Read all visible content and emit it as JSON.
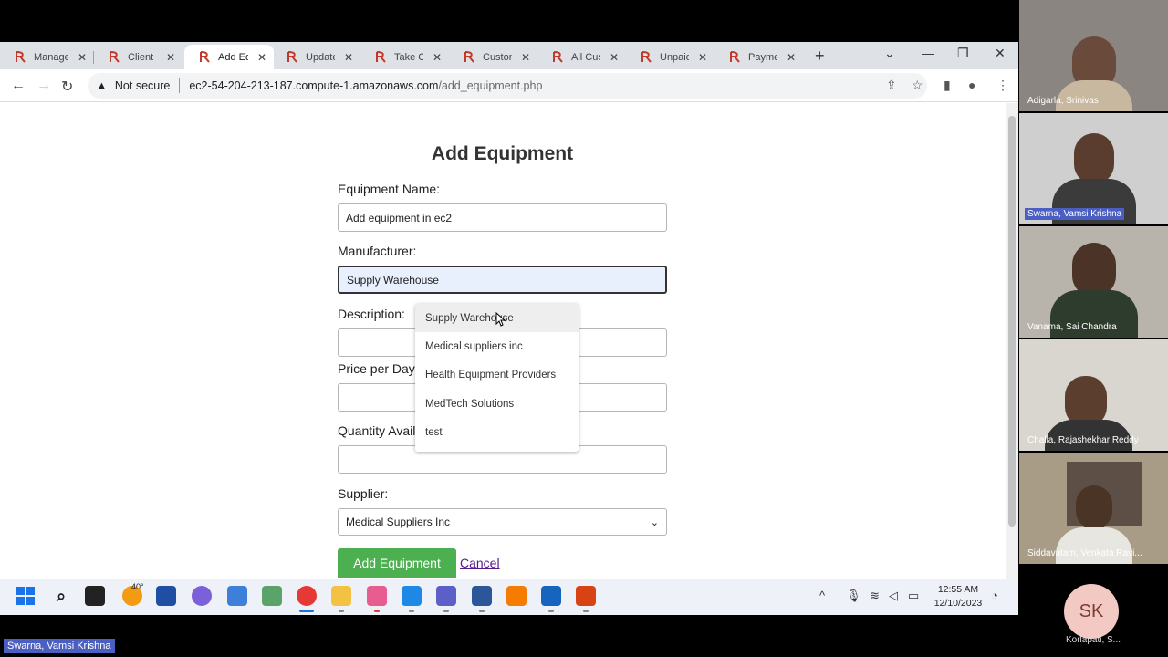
{
  "tabs": [
    {
      "label": "Manage"
    },
    {
      "label": "Client D"
    },
    {
      "label": "Add Equ"
    },
    {
      "label": "Update"
    },
    {
      "label": "Take Or"
    },
    {
      "label": "Custom"
    },
    {
      "label": "All Cust"
    },
    {
      "label": "Unpaid"
    },
    {
      "label": "Paymen"
    }
  ],
  "address_bar": {
    "security_text": "Not secure",
    "host": "ec2-54-204-213-187.compute-1.amazonaws.com",
    "path": "/add_equipment.php"
  },
  "form": {
    "title": "Add Equipment",
    "equipment_name_label": "Equipment Name:",
    "equipment_name_value": "Add equipment in ec2",
    "manufacturer_label": "Manufacturer:",
    "manufacturer_value": "Supply Warehouse",
    "description_label": "Description:",
    "price_label": "Price per Day",
    "quantity_label": "Quantity Avail",
    "supplier_label": "Supplier:",
    "supplier_value": "Medical Suppliers Inc",
    "submit_label": "Add Equipment",
    "cancel_label": "Cancel"
  },
  "autocomplete": [
    "Supply Warehouse",
    "Medical suppliers inc",
    "Health Equipment Providers",
    "MedTech Solutions",
    "test"
  ],
  "taskbar": {
    "weather": "40°",
    "time": "12:55 AM",
    "date": "12/10/2023"
  },
  "participants": [
    {
      "name": "Adigarla, Srinivas"
    },
    {
      "name": "Swarna, Vamsi Krishna"
    },
    {
      "name": "Vanama, Sai Chandra"
    },
    {
      "name": "Challa, Rajashekhar Reddy"
    },
    {
      "name": "Siddavatam, Venkata Ravi..."
    }
  ],
  "avatar_participant": {
    "initials": "SK",
    "name": "Korlapati, S..."
  },
  "active_speaker": "Swarna, Vamsi Krishna",
  "colors": {
    "accent": "#4caf50",
    "speaker_badge": "#4a5fc1"
  }
}
